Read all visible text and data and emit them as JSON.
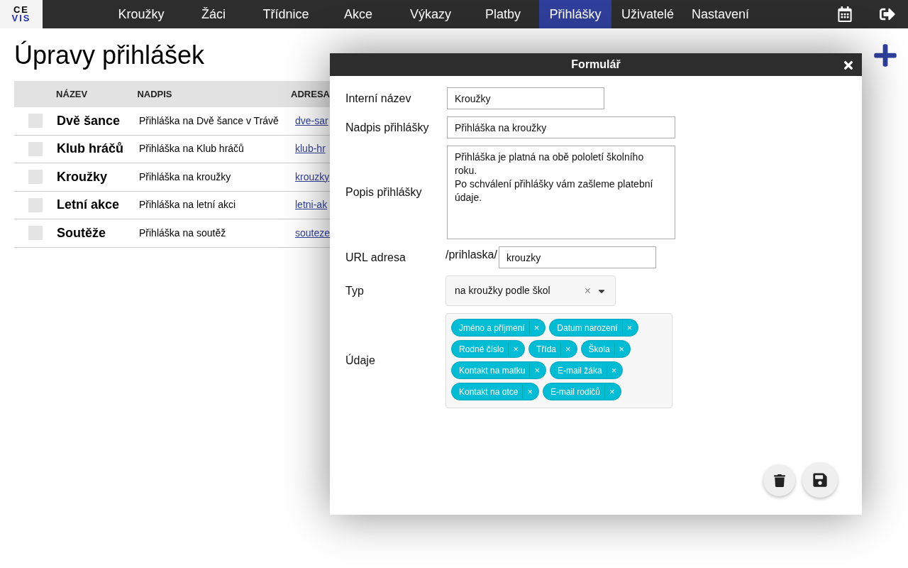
{
  "logo": {
    "top": "CE",
    "bottom": "VIS"
  },
  "nav": [
    {
      "label": "Kroužky",
      "selected": false
    },
    {
      "label": "Žáci",
      "selected": false
    },
    {
      "label": "Třídnice",
      "selected": false
    },
    {
      "label": "Akce",
      "selected": false
    },
    {
      "label": "Výkazy",
      "selected": false
    },
    {
      "label": "Platby",
      "selected": false
    },
    {
      "label": "Přihlášky",
      "selected": true
    },
    {
      "label": "Uživatelé",
      "selected": false
    },
    {
      "label": "Nastavení",
      "selected": false
    }
  ],
  "page_title": "Úpravy přihlášek",
  "table": {
    "columns": [
      "NÁZEV",
      "NADPIS",
      "ADRESA"
    ],
    "rows": [
      {
        "checked": false,
        "name": "Dvě šance",
        "heading": "Přihláška na Dvě šance v Trávě",
        "address": "dve-sar"
      },
      {
        "checked": false,
        "name": "Klub hráčů",
        "heading": "Přihláška na Klub hráčů",
        "address": "klub-hr"
      },
      {
        "checked": false,
        "name": "Kroužky",
        "heading": "Přihláška na kroužky",
        "address": "krouzky"
      },
      {
        "checked": false,
        "name": "Letní akce",
        "heading": "Přihláška na letní akci",
        "address": "letni-ak"
      },
      {
        "checked": false,
        "name": "Soutěže",
        "heading": "Přihláška na soutěž",
        "address": "souteze"
      }
    ]
  },
  "dialog": {
    "title": "Formulář",
    "internal_name": {
      "label": "Interní název",
      "value": "Kroužky"
    },
    "heading": {
      "label": "Nadpis přihlášky",
      "value": "Přihláška na kroužky"
    },
    "description": {
      "label": "Popis přihlášky",
      "value": "Přihláška je platná na obě pololetí školního roku.\nPo schválení přihlášky vám zašleme platební údaje."
    },
    "url": {
      "label": "URL adresa",
      "prefix": "/prihlaska/",
      "value": "krouzky"
    },
    "type": {
      "label": "Typ",
      "value": "na kroužky podle škol",
      "clear": "×"
    },
    "fields": {
      "label": "Údaje",
      "tags": [
        {
          "label": "Jméno a příjmení",
          "remove": "×"
        },
        {
          "label": "Datum narození",
          "remove": "×"
        },
        {
          "label": "Rodné číslo",
          "remove": "×"
        },
        {
          "label": "Třída",
          "remove": "×"
        },
        {
          "label": "Škola",
          "remove": "×"
        },
        {
          "label": "Kontakt na matku",
          "remove": "×"
        },
        {
          "label": "E-mail žáka",
          "remove": "×"
        },
        {
          "label": "Kontakt na otce",
          "remove": "×"
        },
        {
          "label": "E-mail rodičů",
          "remove": "×"
        }
      ]
    }
  }
}
